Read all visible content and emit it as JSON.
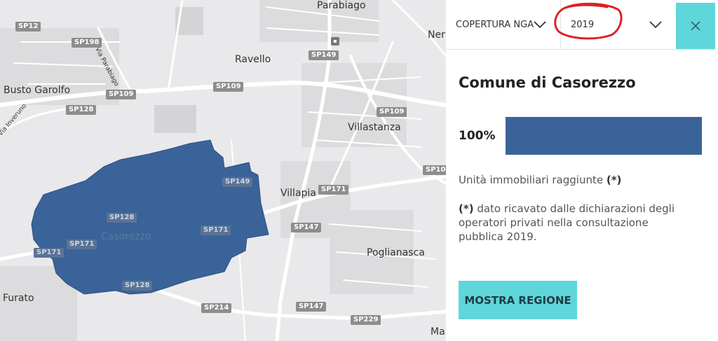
{
  "map": {
    "places": {
      "parabiago": "Parabiago",
      "ravello": "Ravello",
      "busto_garolfo": "Busto Garolfo",
      "villastanza": "Villastanza",
      "villapia": "Villapia",
      "casorezzo": "Casorezzo",
      "poglianasca": "Poglianasca",
      "furato": "Furato",
      "ner": "Ner",
      "ma": "Ma",
      "via_parabiago": "Via Parabiago",
      "via_inveruno": "Via Inveruno"
    },
    "roads": {
      "sp12": "SP12",
      "sp198": "SP198",
      "sp149_a": "SP149",
      "sp109_a": "SP109",
      "sp109_b": "SP109",
      "sp128_a": "SP128",
      "sp109_c": "SP109",
      "sp109_d": "SP109",
      "sp171_a": "SP171",
      "sp147_a": "SP147",
      "sp147_b": "SP147",
      "sp214": "SP214",
      "sp229": "SP229",
      "sp149_b": "SP149",
      "sp128_b": "SP128",
      "sp171_b": "SP171",
      "sp171_c": "SP171",
      "sp128_c": "SP128",
      "sp171_d": "SP171"
    },
    "colors": {
      "background": "#e9e9eb",
      "roads": "#ffffff",
      "highlight": "#3a6399"
    }
  },
  "panel": {
    "dropdown_type": "COPERTURA NGA",
    "dropdown_year": "2019",
    "title": "Comune di Casorezzo",
    "percentage_label": "100%",
    "coverage_fraction": 1.0,
    "description": "Unità immobiliari raggiunte",
    "description_marker": "(*)",
    "note_marker": "(*)",
    "note_text": " dato ricavato dalle dichiarazioni degli operatori privati nella consultazione pubblica 2019.",
    "button_label": "MOSTRA REGIONE",
    "colors": {
      "accent": "#5fd6da",
      "bar": "#3a6399",
      "annotation": "#e02020"
    }
  }
}
